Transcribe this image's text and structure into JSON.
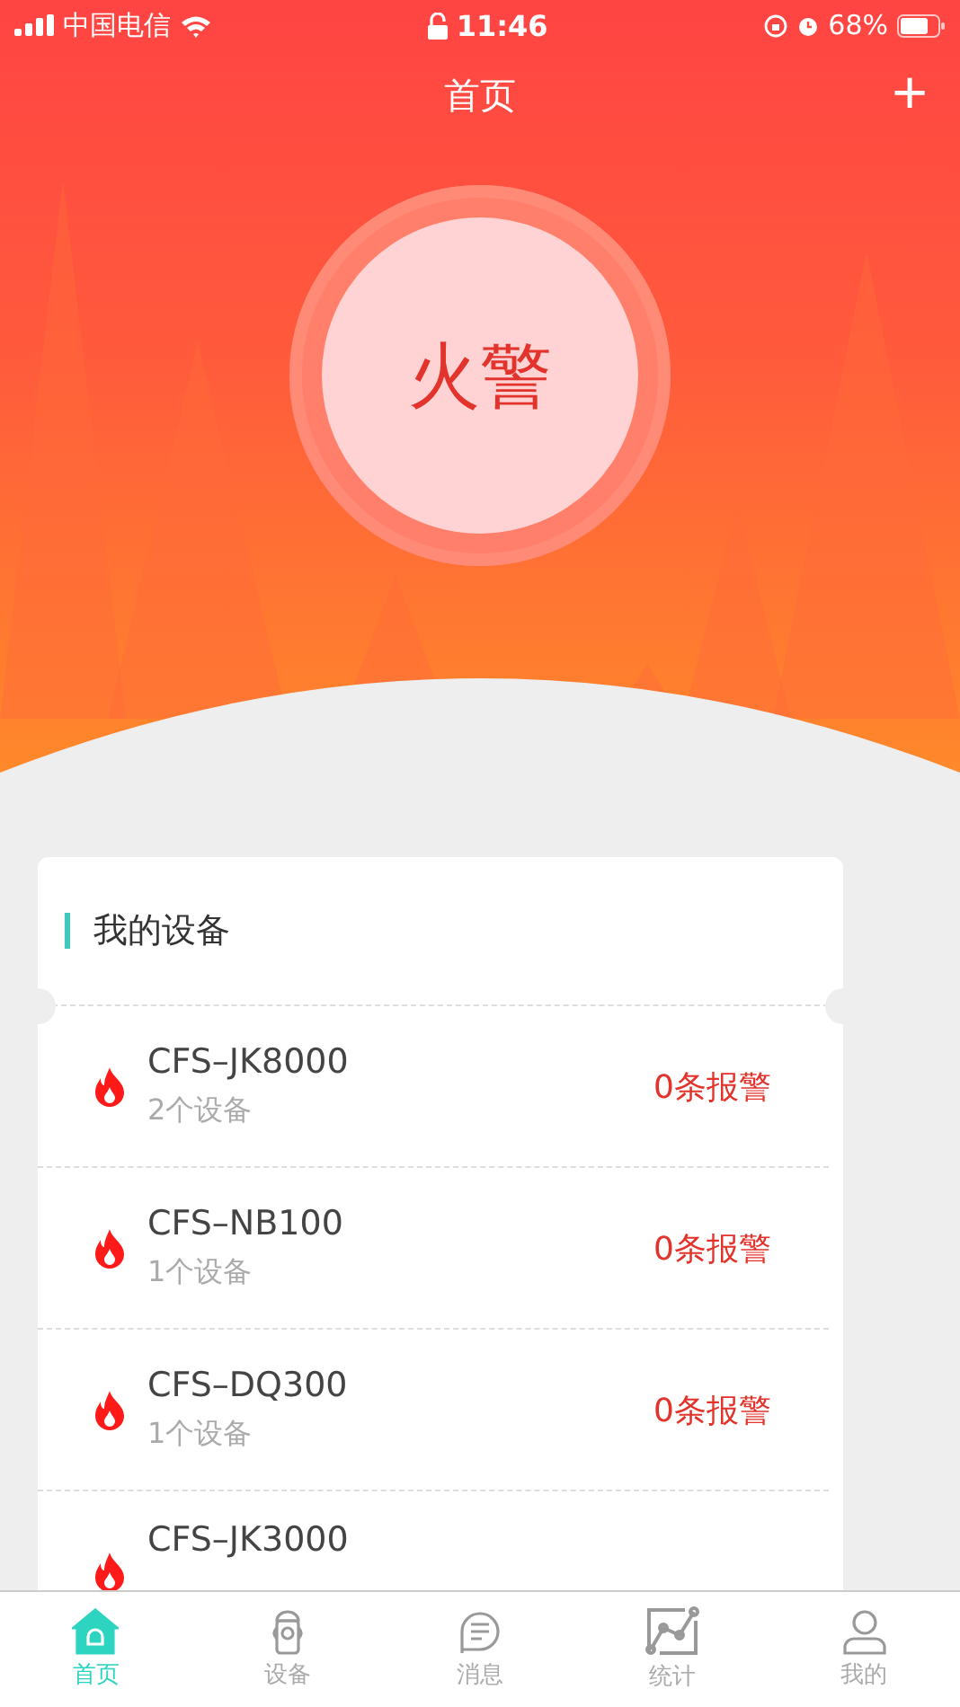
{
  "status_bar": {
    "carrier": "中国电信",
    "time": "11:46",
    "battery": "68%"
  },
  "nav": {
    "title": "首页",
    "add": "+"
  },
  "alarm_button": {
    "label": "火警"
  },
  "devices": {
    "title": "我的设备",
    "items": [
      {
        "name": "CFS–JK8000",
        "count": "2个设备",
        "alarms": "0条报警"
      },
      {
        "name": "CFS–NB100",
        "count": "1个设备",
        "alarms": "0条报警"
      },
      {
        "name": "CFS–DQ300",
        "count": "1个设备",
        "alarms": "0条报警"
      },
      {
        "name": "CFS–JK3000"
      }
    ]
  },
  "tab_bar": [
    {
      "kind": "home",
      "label": "首页",
      "selected": true
    },
    {
      "kind": "device",
      "label": "设备",
      "selected": false
    },
    {
      "kind": "message",
      "label": "消息",
      "selected": false
    },
    {
      "kind": "stats",
      "label": "统计",
      "selected": false
    },
    {
      "kind": "profile",
      "label": "我的",
      "selected": false
    }
  ]
}
